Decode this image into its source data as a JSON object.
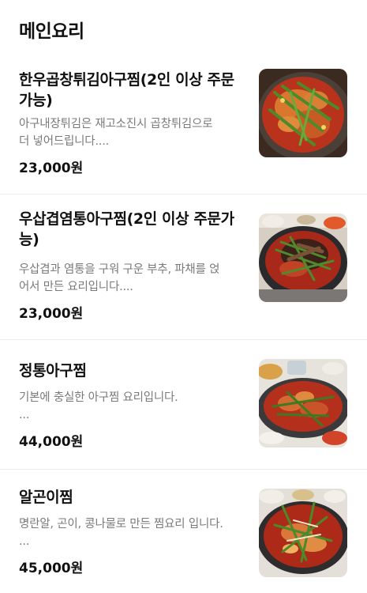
{
  "section": {
    "title": "메인요리"
  },
  "items": [
    {
      "name": "한우곱창튀김아구찜(2인 이상 주문가능)",
      "description_lines": [
        "아구내장튀김은 재고소진시 곱창튀김으로",
        "더 넣어드립니다...."
      ],
      "price": "23,000원",
      "image_icon": "braised-monkfish-fried-tripe-photo"
    },
    {
      "name": "우삽겹염통아구찜(2인 이상 주문가능)",
      "description_lines": [
        "우삽겹과 염통을 구워 구운 부추, 파채를 얹",
        "어서 만든 요리입니다...."
      ],
      "price": "23,000원",
      "image_icon": "braised-monkfish-pork-heart-photo"
    },
    {
      "name": "정통아구찜",
      "description_lines": [
        "기본에 충실한 아구찜 요리입니다.",
        "..."
      ],
      "price": "44,000원",
      "image_icon": "traditional-braised-monkfish-photo"
    },
    {
      "name": "알곤이찜",
      "description_lines": [
        "명란알, 곤이, 콩나물로 만든 찜요리 입니다.",
        "..."
      ],
      "price": "45,000원",
      "image_icon": "braised-roe-photo"
    }
  ]
}
